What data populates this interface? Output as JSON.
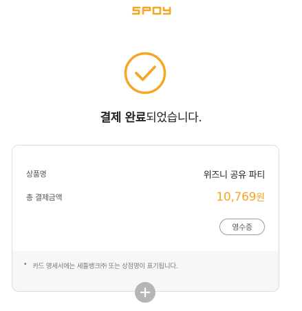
{
  "brand": {
    "logo_text": "spoy",
    "accent_color": "#f5a623"
  },
  "status": {
    "icon": "check-circle-icon",
    "title_strong": "결제 완료",
    "title_rest": "되었습니다."
  },
  "order": {
    "product_label": "상품명",
    "product_name": "위즈니 공유 파티",
    "total_label": "총 결제금액",
    "total_amount": "10,769",
    "currency_unit": "원",
    "receipt_button": "영수증"
  },
  "notice": {
    "bullet": "•",
    "text": "카드 명세서에는 세틀뱅크㈜ 또는 상점명이 표기됩니다."
  },
  "actions": {
    "expand_icon": "plus-icon"
  }
}
